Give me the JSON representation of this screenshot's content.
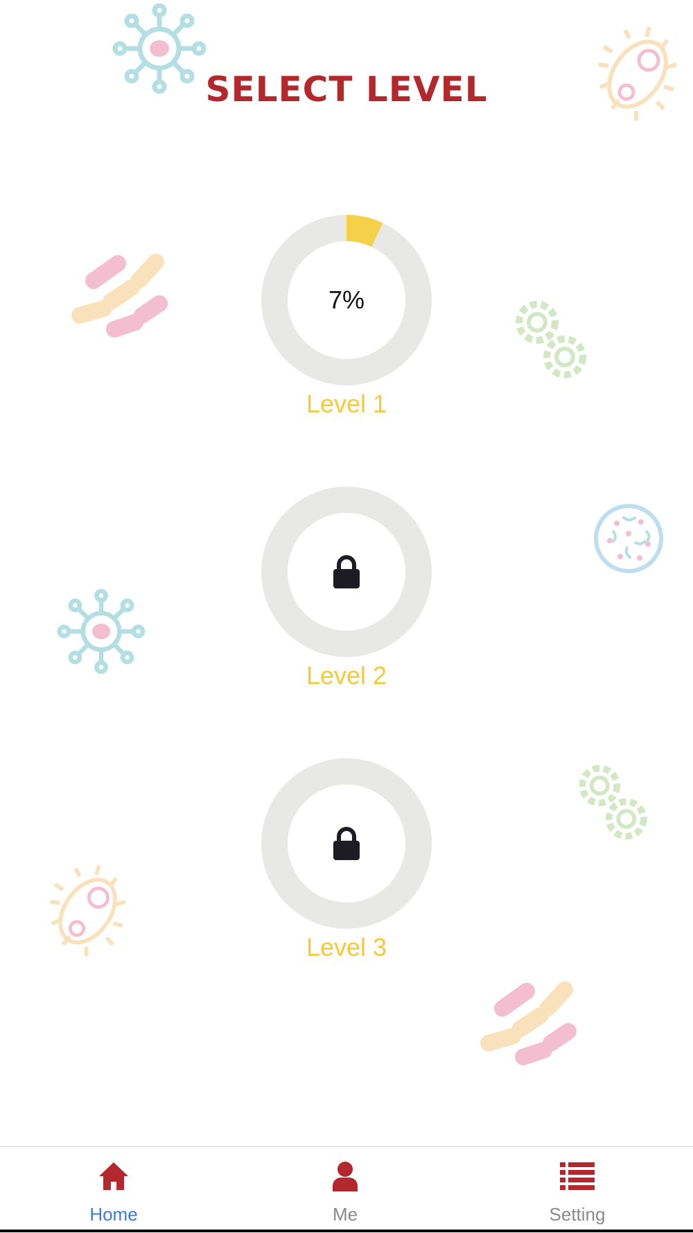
{
  "header": {
    "title": "SELECT LEVEL"
  },
  "colors": {
    "title": "#b3282d",
    "ring_track": "#e8e9e7",
    "ring_progress": "#f5d14a",
    "level_label": "#f5c93a",
    "tab_active": "#3b7be0",
    "tab_inactive": "#8a8a8a",
    "tab_icon": "#b3282d"
  },
  "levels": [
    {
      "label": "Level 1",
      "progress_text": "7%",
      "progress": 0.07,
      "locked": false
    },
    {
      "label": "Level 2",
      "progress_text": "",
      "progress": 0,
      "locked": true
    },
    {
      "label": "Level 3",
      "progress_text": "",
      "progress": 0,
      "locked": true
    }
  ],
  "tabbar": {
    "items": [
      {
        "label": "Home",
        "icon": "home-icon",
        "active": true
      },
      {
        "label": "Me",
        "icon": "user-icon",
        "active": false
      },
      {
        "label": "Setting",
        "icon": "list-icon",
        "active": false
      }
    ]
  }
}
